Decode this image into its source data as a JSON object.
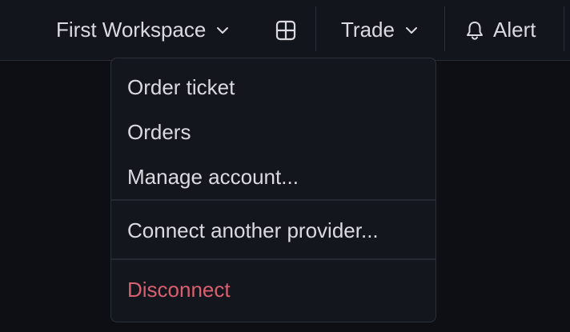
{
  "topbar": {
    "workspace_label": "First Workspace",
    "trade_label": "Trade",
    "alert_label": "Alert"
  },
  "icons": {
    "workspace_chevron": "chevron-down-icon",
    "layout": "layout-grid-icon",
    "trade_chevron": "chevron-down-icon",
    "alert": "bell-icon"
  },
  "menu": {
    "items": [
      {
        "label": "Order ticket"
      },
      {
        "label": "Orders"
      },
      {
        "label": "Manage account..."
      }
    ],
    "connect_label": "Connect another provider...",
    "disconnect_label": "Disconnect"
  },
  "colors": {
    "background": "#0d0f15",
    "topbar": "#13151c",
    "menu": "#14161d",
    "danger": "#d9606f",
    "text": "#d9dbe0"
  }
}
